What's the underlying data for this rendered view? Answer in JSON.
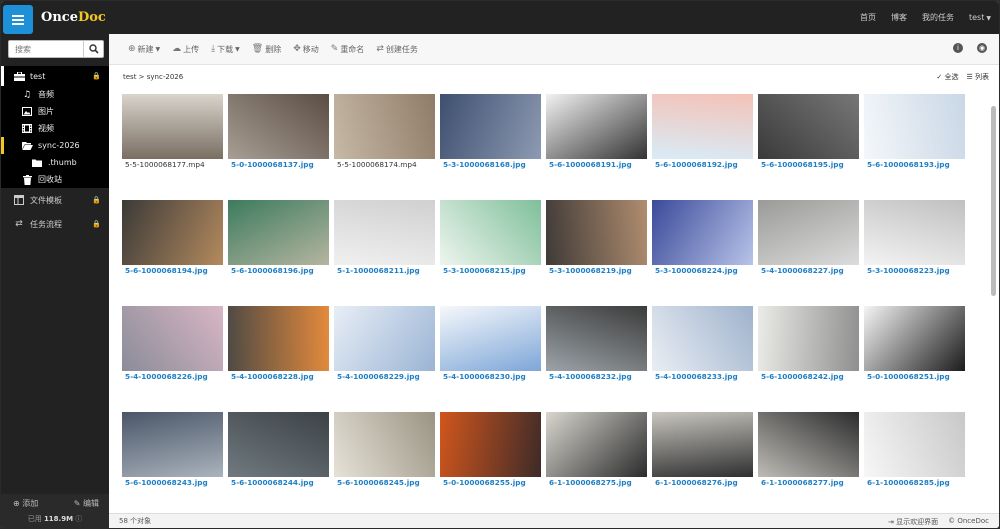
{
  "brand": {
    "name_a": "Once",
    "name_b": "Doc"
  },
  "topnav": {
    "home": "首页",
    "blog": "博客",
    "tasks": "我的任务",
    "user": "test"
  },
  "sidebar": {
    "search_placeholder": "搜索",
    "root": "test",
    "items": [
      {
        "label": "音频",
        "icon": "music-icon"
      },
      {
        "label": "图片",
        "icon": "image-icon"
      },
      {
        "label": "视频",
        "icon": "film-icon"
      },
      {
        "label": "sync-2026",
        "icon": "folder-open-icon"
      },
      {
        "label": ".thumb",
        "icon": "folder-icon"
      },
      {
        "label": "回收站",
        "icon": "trash-icon"
      }
    ],
    "sections": [
      {
        "label": "文件模板",
        "icon": "template-icon"
      },
      {
        "label": "任务流程",
        "icon": "workflow-icon"
      }
    ],
    "add_label": "添加",
    "edit_label": "编辑",
    "usage_prefix": "已用",
    "usage_value": "118.9M"
  },
  "toolbar": {
    "new": "新建",
    "upload": "上传",
    "download": "下载",
    "delete": "删除",
    "move": "移动",
    "rename": "重命名",
    "create_task": "创建任务"
  },
  "breadcrumb": {
    "path": "test > sync-2026",
    "select_all": "全选",
    "list_view": "列表"
  },
  "files": [
    {
      "name": "5-5-1000068177.mp4",
      "type": "video",
      "c1": "#7a6e62",
      "c2": "#d9d4cc"
    },
    {
      "name": "5-0-1000068137.jpg",
      "type": "image",
      "c1": "#a89e94",
      "c2": "#5a4d44"
    },
    {
      "name": "5-5-1000068174.mp4",
      "type": "video",
      "c1": "#c6b9a6",
      "c2": "#8f7c68"
    },
    {
      "name": "5-3-1000068168.jpg",
      "type": "image",
      "c1": "#3e4f6f",
      "c2": "#8d9ab3"
    },
    {
      "name": "5-6-1000068191.jpg",
      "type": "image",
      "c1": "#f2f2f2",
      "c2": "#333333"
    },
    {
      "name": "5-6-1000068192.jpg",
      "type": "image",
      "c1": "#d8ecf7",
      "c2": "#f4c2b8"
    },
    {
      "name": "5-6-1000068195.jpg",
      "type": "image",
      "c1": "#3a3a3a",
      "c2": "#777777"
    },
    {
      "name": "5-6-1000068193.jpg",
      "type": "image",
      "c1": "#f4f7fa",
      "c2": "#c9d7e6"
    },
    {
      "name": "5-6-1000068194.jpg",
      "type": "image",
      "c1": "#3b3a38",
      "c2": "#b48a5e"
    },
    {
      "name": "5-6-1000068196.jpg",
      "type": "image",
      "c1": "#3c7b5e",
      "c2": "#b5b5a0"
    },
    {
      "name": "5-1-1000068211.jpg",
      "type": "image",
      "c1": "#f0f0f0",
      "c2": "#d0d0d0"
    },
    {
      "name": "5-3-1000068215.jpg",
      "type": "image",
      "c1": "#eef5ee",
      "c2": "#7fbf9a"
    },
    {
      "name": "5-3-1000068219.jpg",
      "type": "image",
      "c1": "#3f3a37",
      "c2": "#b08d6f"
    },
    {
      "name": "5-3-1000068224.jpg",
      "type": "image",
      "c1": "#3a4a9a",
      "c2": "#b8c3e8"
    },
    {
      "name": "5-4-1000068227.jpg",
      "type": "image",
      "c1": "#9a9a98",
      "c2": "#dcdcdc"
    },
    {
      "name": "5-3-1000068223.jpg",
      "type": "image",
      "c1": "#f3f3f3",
      "c2": "#c0c0c0"
    },
    {
      "name": "5-4-1000068226.jpg",
      "type": "image",
      "c1": "#8b8c99",
      "c2": "#d8b6c4"
    },
    {
      "name": "5-4-1000068228.jpg",
      "type": "image",
      "c1": "#4f4a44",
      "c2": "#e48a3c"
    },
    {
      "name": "5-4-1000068229.jpg",
      "type": "image",
      "c1": "#e8eef6",
      "c2": "#9ab4d4"
    },
    {
      "name": "5-4-1000068230.jpg",
      "type": "image",
      "c1": "#f6f8fb",
      "c2": "#7da6d8"
    },
    {
      "name": "5-4-1000068232.jpg",
      "type": "image",
      "c1": "#9ca3a8",
      "c2": "#3b3b3b"
    },
    {
      "name": "5-4-1000068233.jpg",
      "type": "image",
      "c1": "#e9eef4",
      "c2": "#9fb2cc"
    },
    {
      "name": "5-6-1000068242.jpg",
      "type": "image",
      "c1": "#ebebe8",
      "c2": "#8f8f8f"
    },
    {
      "name": "5-0-1000068251.jpg",
      "type": "image",
      "c1": "#f5f5f5",
      "c2": "#1b1b1b"
    },
    {
      "name": "5-6-1000068243.jpg",
      "type": "image",
      "c1": "#4a5668",
      "c2": "#aab3bd"
    },
    {
      "name": "5-6-1000068244.jpg",
      "type": "image",
      "c1": "#707a80",
      "c2": "#3c4246"
    },
    {
      "name": "5-6-1000068245.jpg",
      "type": "image",
      "c1": "#e6e2d8",
      "c2": "#9b9484"
    },
    {
      "name": "5-0-1000068255.jpg",
      "type": "image",
      "c1": "#d0561d",
      "c2": "#3e2a28"
    },
    {
      "name": "6-1-1000068275.jpg",
      "type": "image",
      "c1": "#d9d6cf",
      "c2": "#2a2b2c"
    },
    {
      "name": "6-1-1000068276.jpg",
      "type": "image",
      "c1": "#c9c6bf",
      "c2": "#2e2f30"
    },
    {
      "name": "6-1-1000068277.jpg",
      "type": "image",
      "c1": "#bfbcb6",
      "c2": "#2b2c2d"
    },
    {
      "name": "6-1-1000068285.jpg",
      "type": "image",
      "c1": "#f7f7f7",
      "c2": "#c8c8c8"
    }
  ],
  "status": {
    "count": "58 个对象",
    "welcome": "显示欢迎界面",
    "copyright": "© OnceDoc"
  }
}
